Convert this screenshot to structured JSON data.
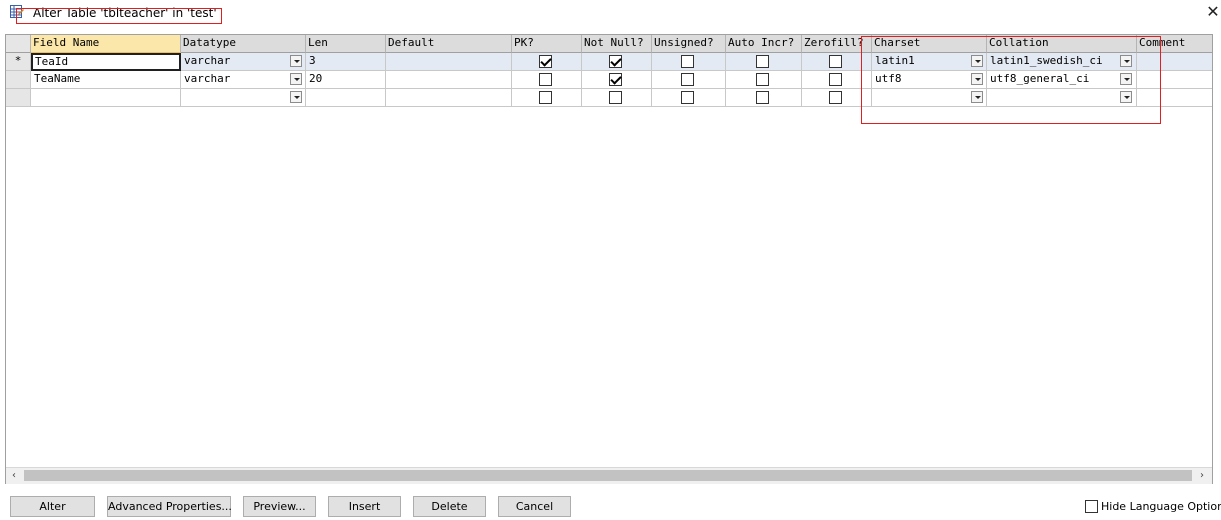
{
  "window": {
    "title": "Alter Table 'tblteacher' in 'test'",
    "close_glyph": "✕"
  },
  "columns": [
    "Field Name",
    "Datatype",
    "Len",
    "Default",
    "PK?",
    "Not Null?",
    "Unsigned?",
    "Auto Incr?",
    "Zerofill?",
    "Charset",
    "Collation",
    "Comment"
  ],
  "rows": [
    {
      "marker": "*",
      "field_name": "TeaId",
      "datatype": "varchar",
      "len": "3",
      "default": "",
      "pk": true,
      "not_null": true,
      "unsigned": false,
      "auto_incr": false,
      "zerofill": false,
      "charset": "latin1",
      "collation": "latin1_swedish_ci",
      "comment": ""
    },
    {
      "marker": "",
      "field_name": "TeaName",
      "datatype": "varchar",
      "len": "20",
      "default": "",
      "pk": false,
      "not_null": true,
      "unsigned": false,
      "auto_incr": false,
      "zerofill": false,
      "charset": "utf8",
      "collation": "utf8_general_ci",
      "comment": ""
    },
    {
      "marker": "",
      "field_name": "",
      "datatype": "",
      "len": "",
      "default": "",
      "pk": false,
      "not_null": false,
      "unsigned": false,
      "auto_incr": false,
      "zerofill": false,
      "charset": "",
      "collation": "",
      "comment": ""
    }
  ],
  "buttons": {
    "alter": "Alter",
    "advanced": "Advanced Properties...",
    "preview": "Preview...",
    "insert": "Insert",
    "delete": "Delete",
    "cancel": "Cancel"
  },
  "hide_language_options": {
    "label": "Hide Language Options",
    "checked": false
  },
  "scroll": {
    "left_glyph": "‹",
    "right_glyph": "›"
  },
  "colors": {
    "annotation": "#e02020",
    "active_header": "#fbe7a9",
    "selected_row": "#e4eaf4"
  }
}
